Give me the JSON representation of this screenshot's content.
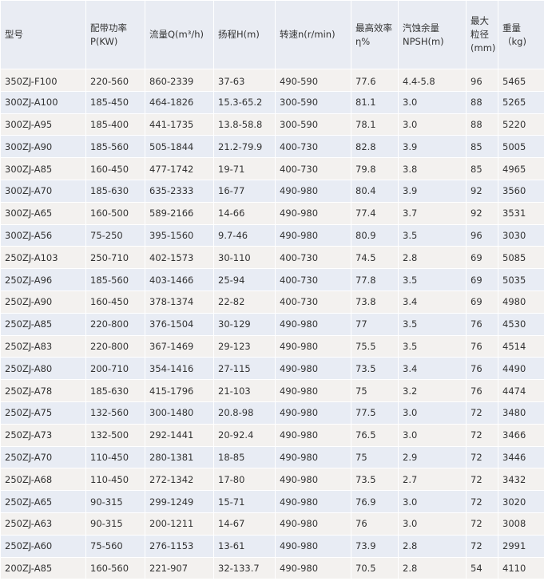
{
  "headers": [
    [
      "型号"
    ],
    [
      "配带功率",
      "P(KW)"
    ],
    [
      "流量Q(m³/h)"
    ],
    [
      "扬程H(m)"
    ],
    [
      "转速n(r/min)"
    ],
    [
      "最高效率",
      "η%"
    ],
    [
      "汽蚀余量",
      "NPSH(m)"
    ],
    [
      "最大",
      "粒径",
      "(mm)"
    ],
    [
      "重量",
      "（kg)"
    ]
  ],
  "rows": [
    [
      "350ZJ-F100",
      "220-560",
      "860-2339",
      "37-63",
      "490-590",
      "77.6",
      "4.4-5.8",
      "96",
      "5465"
    ],
    [
      "300ZJ-A100",
      "185-450",
      "464-1826",
      "15.3-65.2",
      "300-590",
      "81.1",
      "3.0",
      "88",
      "5265"
    ],
    [
      "300ZJ-A95",
      "185-400",
      "441-1735",
      "13.8-58.8",
      "300-590",
      "78.1",
      "3.0",
      "88",
      "5220"
    ],
    [
      "300ZJ-A90",
      "185-560",
      "505-1844",
      "21.2-79.9",
      "400-730",
      "82.8",
      "3.9",
      "85",
      "5005"
    ],
    [
      "300ZJ-A85",
      "160-450",
      "477-1742",
      "19-71",
      "400-730",
      "79.8",
      "3.8",
      "85",
      "4965"
    ],
    [
      "300ZJ-A70",
      "185-630",
      "635-2333",
      "16-77",
      "490-980",
      "80.4",
      "3.9",
      "92",
      "3560"
    ],
    [
      "300ZJ-A65",
      "160-500",
      "589-2166",
      "14-66",
      "490-980",
      "77.4",
      "3.7",
      "92",
      "3531"
    ],
    [
      "300ZJ-A56",
      "75-250",
      "395-1560",
      "9.7-46",
      "490-980",
      "80.9",
      "3.5",
      "96",
      "3030"
    ],
    [
      "250ZJ-A103",
      "250-710",
      "402-1573",
      "30-110",
      "400-730",
      "74.5",
      "2.8",
      "69",
      "5085"
    ],
    [
      "250ZJ-A96",
      "185-560",
      "403-1466",
      "25-94",
      "400-730",
      "77.8",
      "3.5",
      "69",
      "5035"
    ],
    [
      "250ZJ-A90",
      "160-450",
      "378-1374",
      "22-82",
      "400-730",
      "73.8",
      "3.4",
      "69",
      "4980"
    ],
    [
      "250ZJ-A85",
      "220-800",
      "376-1504",
      "30-129",
      "490-980",
      "77",
      "3.5",
      "76",
      "4530"
    ],
    [
      "250ZJ-A83",
      "220-800",
      "367-1469",
      "29-123",
      "490-980",
      "75.5",
      "3.5",
      "76",
      "4514"
    ],
    [
      "250ZJ-A80",
      "200-710",
      "354-1416",
      "27-115",
      "490-980",
      "73.5",
      "3.4",
      "76",
      "4490"
    ],
    [
      "250ZJ-A78",
      "185-630",
      "415-1796",
      "21-103",
      "490-980",
      "75",
      "3.2",
      "76",
      "4474"
    ],
    [
      "250ZJ-A75",
      "132-560",
      "300-1480",
      "20.8-98",
      "490-980",
      "77.5",
      "3.0",
      "72",
      "3480"
    ],
    [
      "250ZJ-A73",
      "132-500",
      "292-1441",
      "20-92.4",
      "490-980",
      "76.5",
      "3.0",
      "72",
      "3466"
    ],
    [
      "250ZJ-A70",
      "110-450",
      "280-1381",
      "18-85",
      "490-980",
      "75",
      "2.9",
      "72",
      "3446"
    ],
    [
      "250ZJ-A68",
      "110-450",
      "272-1342",
      "17-80",
      "490-980",
      "73.5",
      "2.7",
      "72",
      "3432"
    ],
    [
      "250ZJ-A65",
      "90-315",
      "299-1249",
      "15-71",
      "490-980",
      "76.9",
      "3.0",
      "72",
      "3020"
    ],
    [
      "250ZJ-A63",
      "90-315",
      "200-1211",
      "14-67",
      "490-980",
      "76",
      "3.0",
      "72",
      "3008"
    ],
    [
      "250ZJ-A60",
      "75-560",
      "276-1153",
      "13-61",
      "490-980",
      "73.9",
      "2.8",
      "72",
      "2991"
    ],
    [
      "200ZJ-A85",
      "160-560",
      "221-907",
      "32-133.7",
      "490-980",
      "70.5",
      "2.8",
      "54",
      "4110"
    ]
  ],
  "colors": {
    "header_bg": "#e9ecf3",
    "row_odd_bg": "#f3f1ef",
    "row_even_bg": "#e8ecf4",
    "text": "#333333"
  }
}
